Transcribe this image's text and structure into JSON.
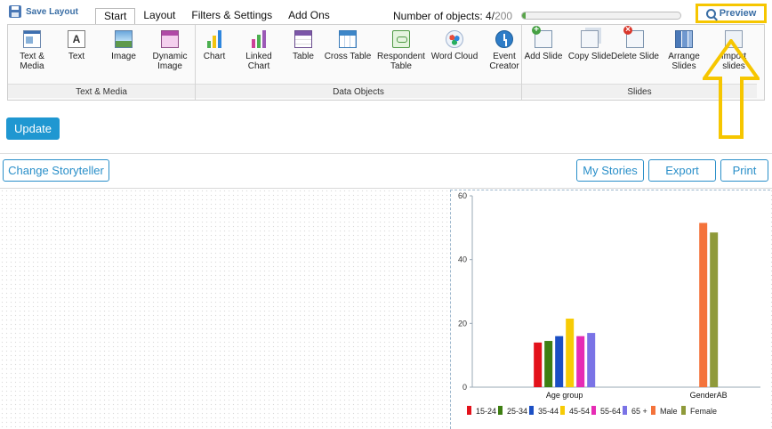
{
  "toolbar": {
    "save_layout": "Save Layout",
    "tabs": [
      {
        "label": "Start",
        "active": true
      },
      {
        "label": "Layout",
        "active": false
      },
      {
        "label": "Filters & Settings",
        "active": false
      },
      {
        "label": "Add Ons",
        "active": false
      }
    ],
    "objects_label": "Number of objects: ",
    "objects_current": "4",
    "objects_max": "200",
    "objects_fraction": 0.02,
    "preview": "Preview"
  },
  "ribbon": {
    "groups": {
      "text_media": "Text & Media",
      "data_objects": "Data Objects",
      "slides": "Slides"
    },
    "buttons": {
      "text_media": "Text & Media",
      "text": "Text",
      "image": "Image",
      "dynamic_image": "Dynamic Image",
      "chart": "Chart",
      "linked_chart": "Linked Chart",
      "table": "Table",
      "cross_table": "Cross Table",
      "respondent_table": "Respondent Table",
      "word_cloud": "Word Cloud",
      "event_creator": "Event Creator",
      "add_slide": "Add Slide",
      "copy_slide": "Copy Slide",
      "delete_slide": "Delete Slide",
      "arrange_slides": "Arrange Slides",
      "import_slides": "Import slides"
    },
    "text_icon_glyph": "A"
  },
  "actions": {
    "update": "Update",
    "change_storyteller": "Change Storyteller",
    "my_stories": "My Stories",
    "export": "Export",
    "print": "Print"
  },
  "colors": {
    "accent": "#2a8fc9",
    "highlight": "#f6c600"
  },
  "chart_data": {
    "type": "bar",
    "categories": [
      "Age group",
      "GenderAB"
    ],
    "ylim": [
      0,
      60
    ],
    "yticks": [
      0,
      20,
      40,
      60
    ],
    "series": [
      {
        "name": "15-24",
        "color": "#e3121b",
        "values": [
          14,
          null
        ]
      },
      {
        "name": "25-34",
        "color": "#3e7f12",
        "values": [
          14.5,
          null
        ]
      },
      {
        "name": "35-44",
        "color": "#1b4fc4",
        "values": [
          16,
          null
        ]
      },
      {
        "name": "45-54",
        "color": "#f7cb05",
        "values": [
          21.5,
          null
        ]
      },
      {
        "name": "55-64",
        "color": "#e62bb4",
        "values": [
          16,
          null
        ]
      },
      {
        "name": "65 +",
        "color": "#7a73e6",
        "values": [
          17,
          null
        ]
      },
      {
        "name": "Male",
        "color": "#f4733b",
        "values": [
          null,
          51.5
        ]
      },
      {
        "name": "Female",
        "color": "#8f9a3a",
        "values": [
          null,
          48.5
        ]
      }
    ]
  }
}
